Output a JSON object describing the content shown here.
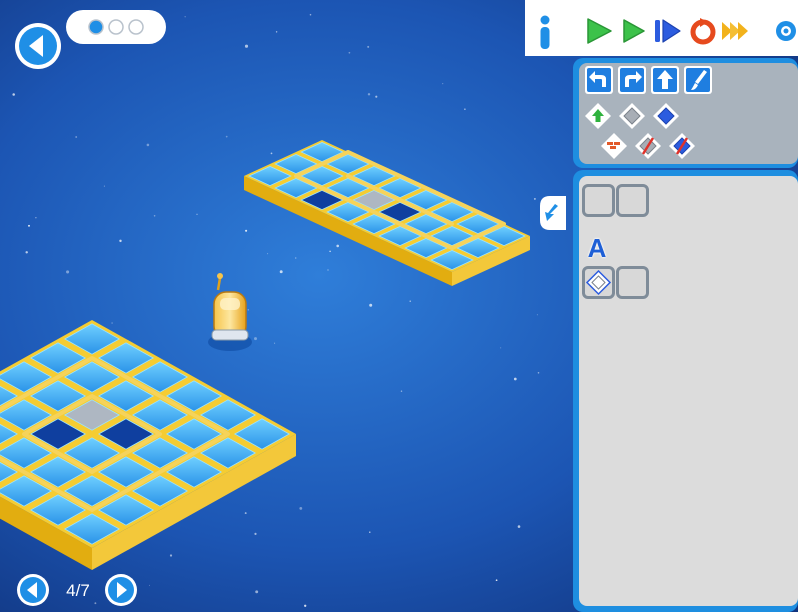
{
  "level": {
    "current": "4/7"
  },
  "progress_dots": {
    "total": 3,
    "filled": 1
  },
  "palette": {
    "moves": [
      "turn-left-icon",
      "turn-right-icon",
      "forward-icon",
      "paint-brush-icon"
    ],
    "conditions": [
      "condition-green-arrow-icon",
      "condition-gray-tile-icon",
      "condition-blue-tile-icon"
    ],
    "negations": [
      "condition-wall-icon",
      "condition-not-gray-icon",
      "condition-not-blue-icon"
    ]
  },
  "program": {
    "main_slots": 2,
    "procedure_label": "A",
    "procedure_slots": 2,
    "procedure_first_condition": "condition-gray-tile-icon"
  },
  "colors": {
    "background": "#1a4fa6",
    "tile": "#38a9f1",
    "tile_dark": "#0f3f9f",
    "platform_edge": "#e8b412",
    "panel": "#1e8ee0",
    "panel_inner": "#dcdcdc",
    "play_green": "#3cc24a",
    "step_blue": "#2c5cdf",
    "reset_red": "#e64a1e",
    "fast_orange": "#f2b21c"
  }
}
